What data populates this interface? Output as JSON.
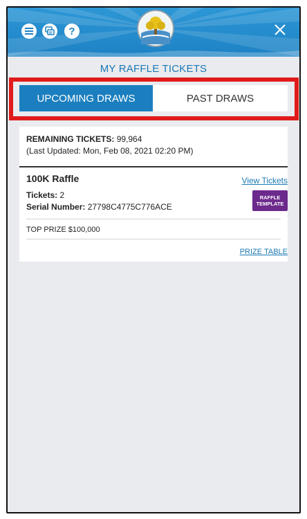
{
  "header": {
    "icons": [
      "menu-icon",
      "chat-icon",
      "help-icon",
      "close-icon"
    ],
    "help_glyph": "?",
    "colors": {
      "header_bg": "#1d82c4",
      "accent": "#1b7fbf",
      "highlight": "#e01b1b",
      "badge": "#6c2a8c"
    }
  },
  "screen": {
    "title": "MY RAFFLE TICKETS"
  },
  "tabs": [
    {
      "label": "UPCOMING DRAWS",
      "active": true
    },
    {
      "label": "PAST DRAWS",
      "active": false
    }
  ],
  "summary": {
    "remaining_label": "REMAINING TICKETS:",
    "remaining_value": "99,964",
    "last_updated": "(Last Updated: Mon, Feb 08, 2021 02:20 PM)"
  },
  "raffle": {
    "name": "100K Raffle",
    "view_tickets": "View Tickets",
    "tickets_label": "Tickets:",
    "tickets_value": "2",
    "serial_label": "Serial Number:",
    "serial_value": "27798C4775C776ACE",
    "badge_line1": "RAFFLE",
    "badge_line2": "TEMPLATE",
    "top_prize": "TOP PRIZE $100,000",
    "prize_table": "PRIZE TABLE"
  }
}
